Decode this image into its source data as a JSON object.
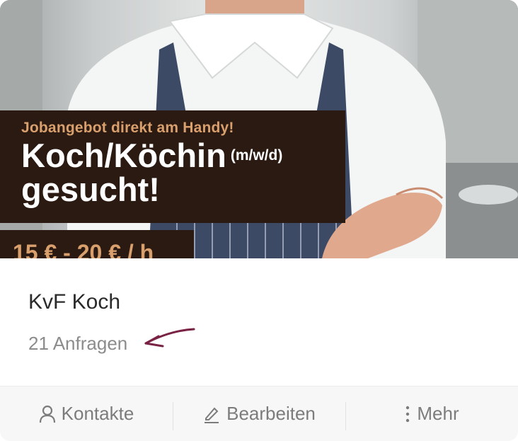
{
  "hero": {
    "tagline": "Jobangebot direkt am Handy!",
    "headline_line1": "Koch/Köchin",
    "gender_tag": "(m/w/d)",
    "headline_line2": "gesucht!",
    "price": "15 € - 20 € / h"
  },
  "job": {
    "title": "KvF Koch",
    "requests": "21 Anfragen"
  },
  "actions": {
    "contacts_label": "Kontakte",
    "edit_label": "Bearbeiten",
    "more_label": "Mehr"
  },
  "icons": {
    "contacts": "person-icon",
    "edit": "pencil-icon",
    "more": "vertical-dots-icon",
    "annotation": "arrow-icon"
  },
  "colors": {
    "banner_bg": "#2b1a12",
    "banner_accent": "#d9a06d",
    "annotation_arrow": "#7a2244"
  }
}
